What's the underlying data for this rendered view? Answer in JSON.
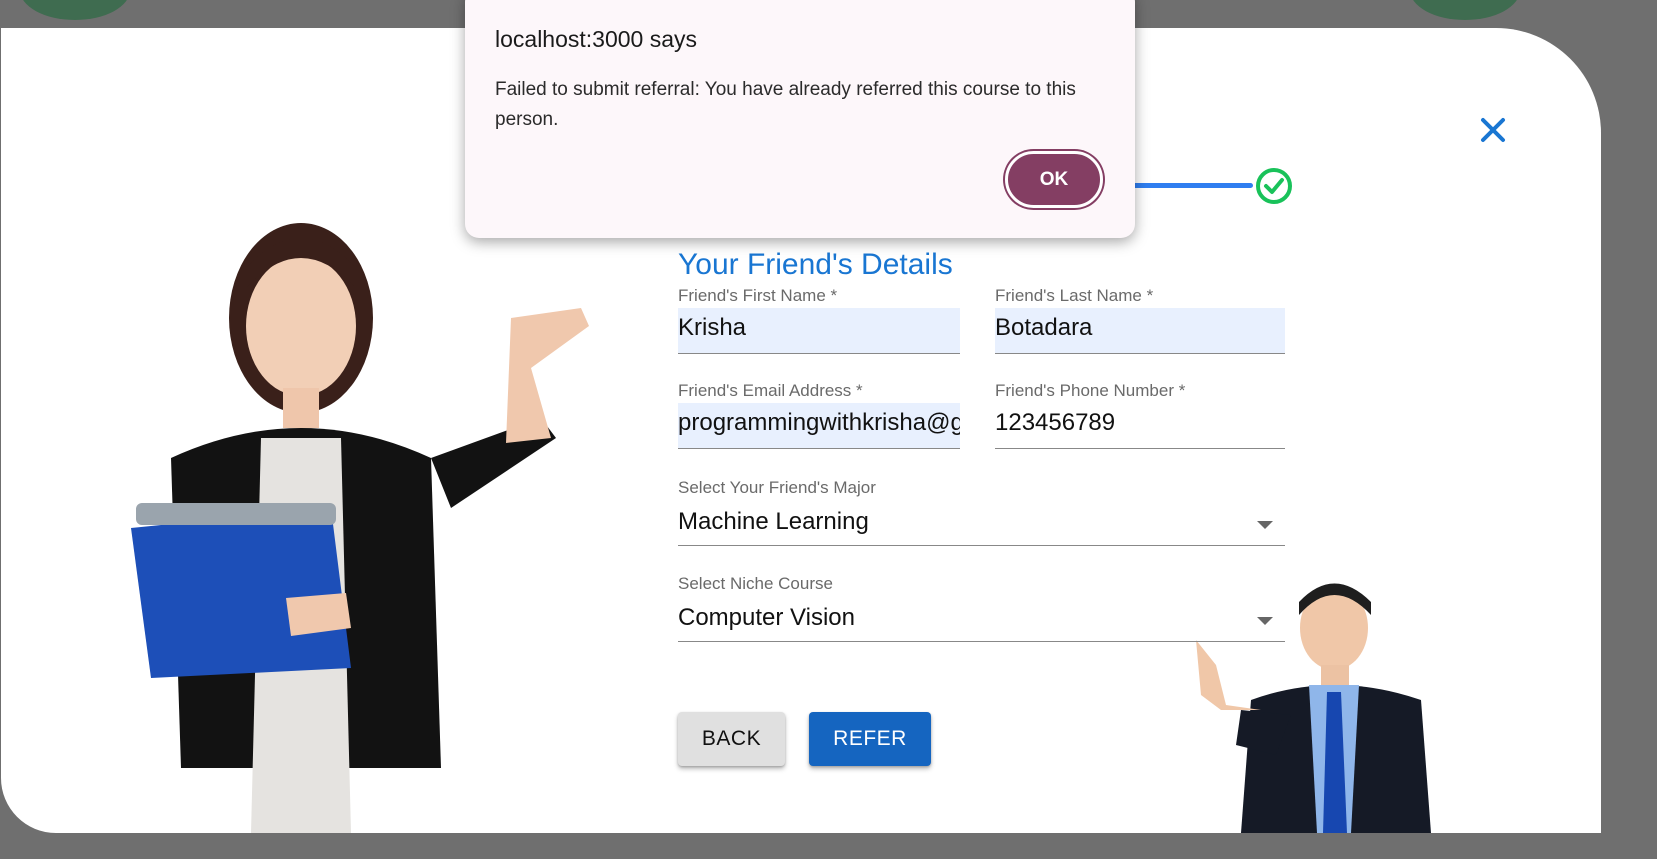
{
  "alert": {
    "title": "localhost:3000 says",
    "message": "Failed to submit referral: You have already referred this course to this person.",
    "ok_label": "OK"
  },
  "form": {
    "title": "Your Friend's Details",
    "first_name": {
      "label": "Friend's First Name *",
      "value": "Krisha"
    },
    "last_name": {
      "label": "Friend's Last Name *",
      "value": "Botadara"
    },
    "email": {
      "label": "Friend's Email Address *",
      "value": "programmingwithkrisha@gmail.com"
    },
    "phone": {
      "label": "Friend's Phone Number *",
      "value": "123456789"
    },
    "major": {
      "label": "Select Your Friend's Major",
      "value": "Machine Learning"
    },
    "course": {
      "label": "Select Niche Course",
      "value": "Computer Vision"
    },
    "back_label": "BACK",
    "refer_label": "REFER"
  },
  "icons": {
    "close": "close-icon",
    "step_done": "check-circle-icon",
    "select_caret": "chevron-down-icon"
  },
  "colors": {
    "accent": "#1976d2",
    "refer_button": "#1565c0",
    "alert_ok": "#843e63",
    "check": "#19c25a"
  }
}
